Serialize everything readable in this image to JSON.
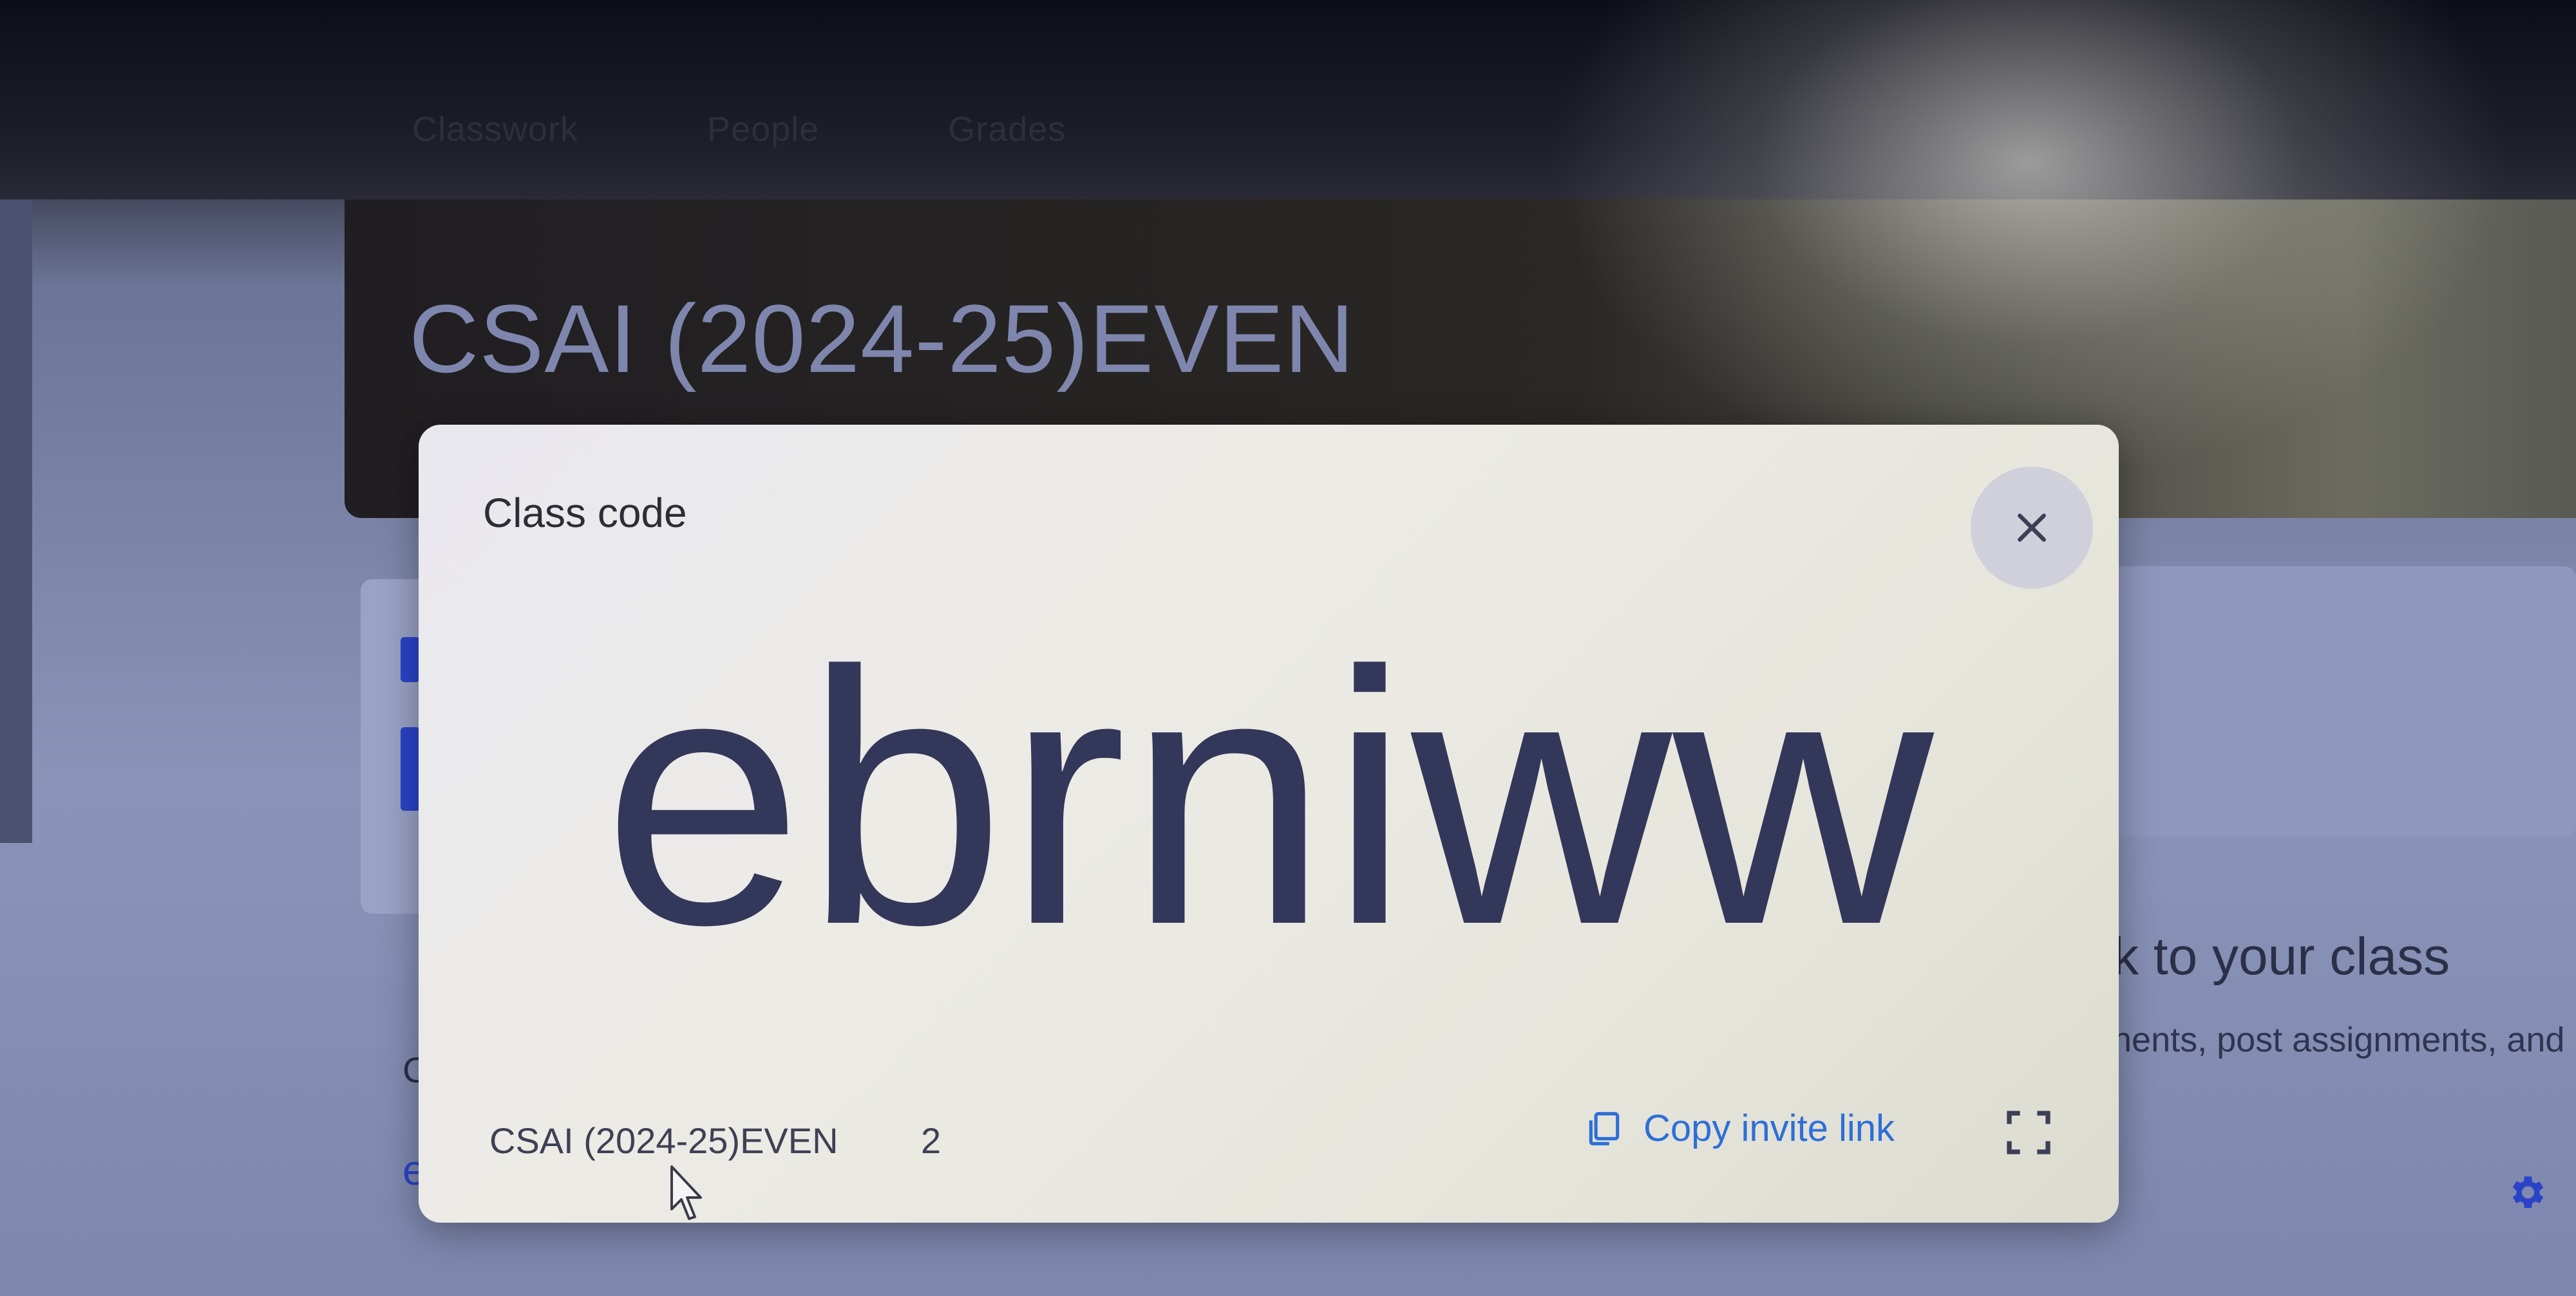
{
  "tabs": [
    {
      "label": "Classwork"
    },
    {
      "label": "People"
    },
    {
      "label": "Grades"
    }
  ],
  "banner": {
    "title": "CSAI (2024-25)EVEN"
  },
  "background": {
    "right_heading": "k to your class",
    "right_sub": "nents, post assignments, and",
    "left_fragment_c": "C",
    "left_fragment_e": "e"
  },
  "modal": {
    "title": "Class code",
    "code": "ebrniww",
    "class_name": "CSAI (2024-25)EVEN",
    "count": "2",
    "copy_link_label": "Copy invite link"
  },
  "icons": {
    "close": "close-icon",
    "copy": "copy-icon",
    "fullscreen": "fullscreen-icon",
    "settings": "gear-icon"
  },
  "colors": {
    "code": "#33375a",
    "link": "#2d6fd8",
    "accent": "#2a44c8"
  }
}
